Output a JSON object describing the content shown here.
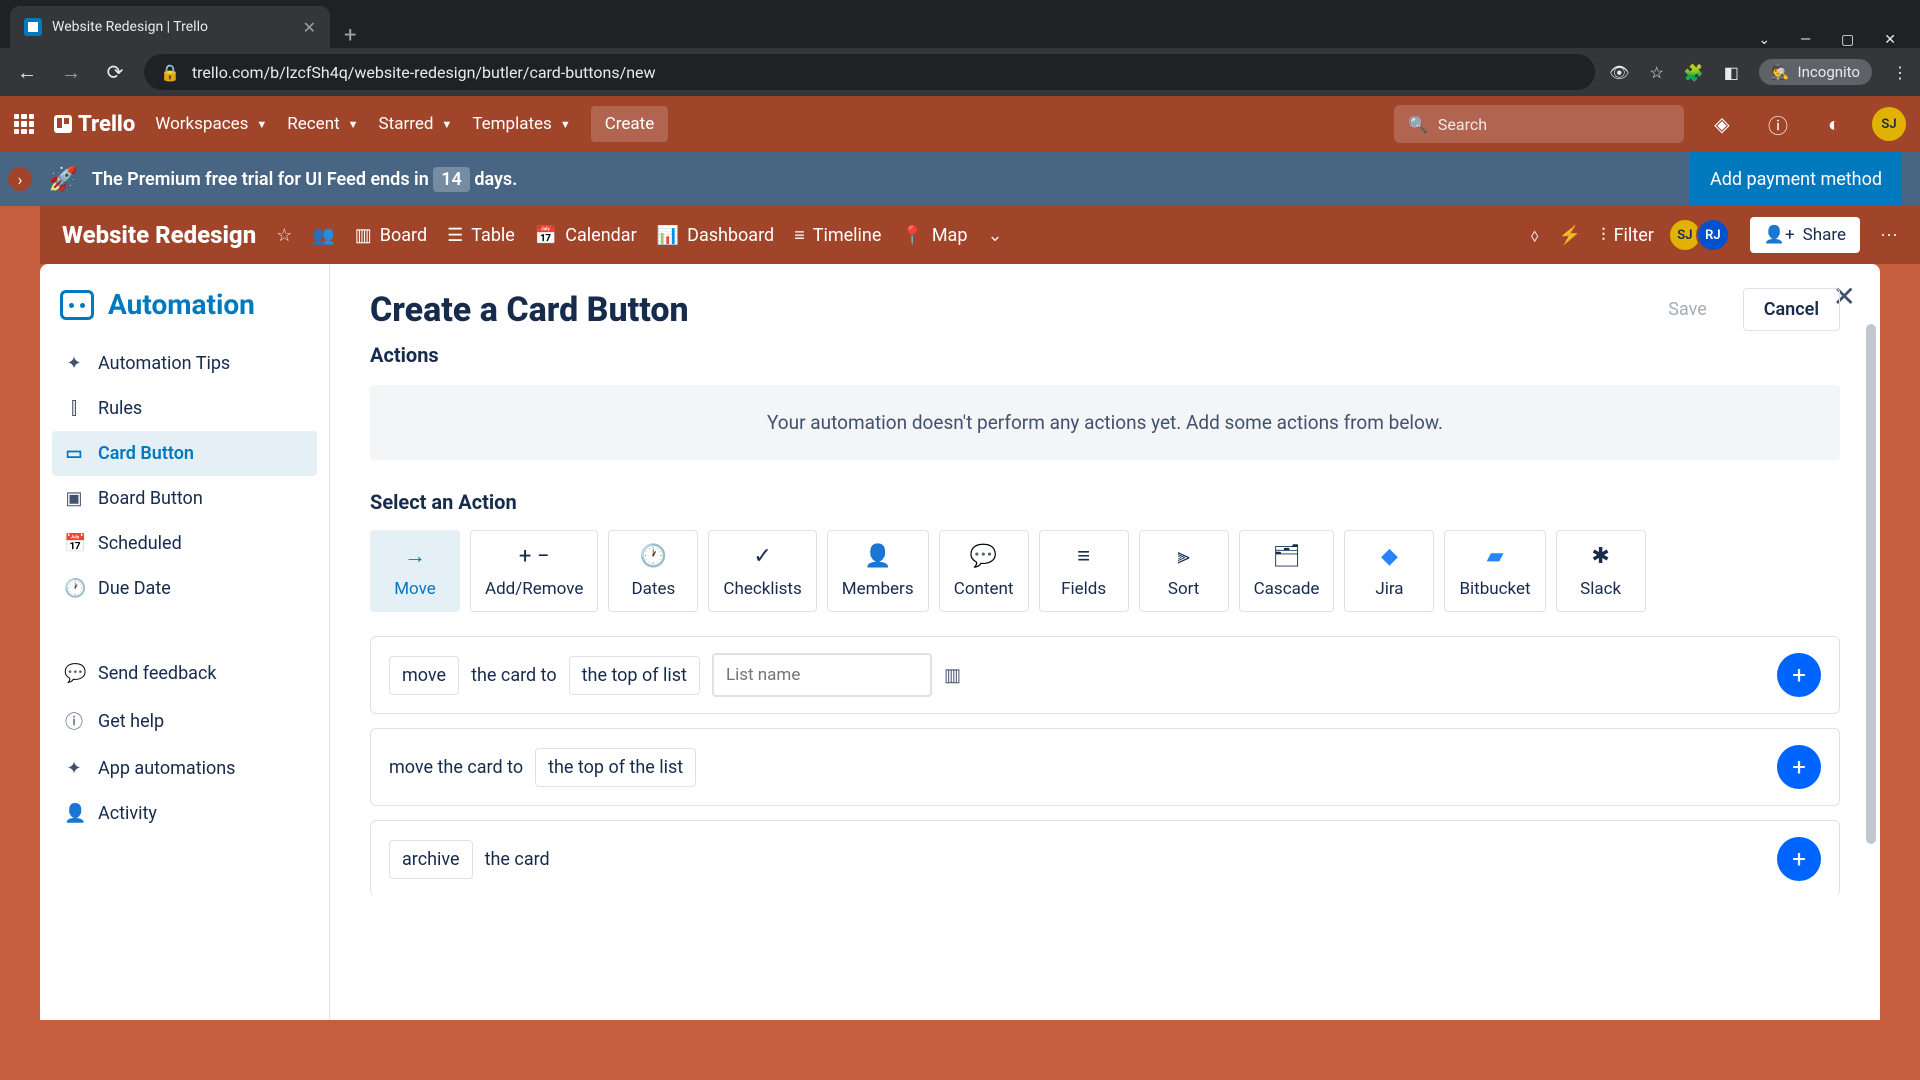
{
  "browser": {
    "tab_title": "Website Redesign | Trello",
    "url": "trello.com/b/lzcfSh4q/website-redesign/butler/card-buttons/new",
    "incognito_label": "Incognito"
  },
  "topnav": {
    "brand": "Trello",
    "workspaces": "Workspaces",
    "recent": "Recent",
    "starred": "Starred",
    "templates": "Templates",
    "create": "Create",
    "search_placeholder": "Search"
  },
  "banner": {
    "text_pre": "The Premium free trial for UI Feed ends in",
    "days": "14",
    "text_post": "days.",
    "cta": "Add payment method"
  },
  "board": {
    "title": "Website Redesign",
    "views": {
      "board": "Board",
      "table": "Table",
      "calendar": "Calendar",
      "dashboard": "Dashboard",
      "timeline": "Timeline",
      "map": "Map"
    },
    "filter": "Filter",
    "share": "Share",
    "members": [
      "SJ",
      "RJ"
    ]
  },
  "automation": {
    "heading": "Automation",
    "sidebar": {
      "tips": "Automation Tips",
      "rules": "Rules",
      "card_button": "Card Button",
      "board_button": "Board Button",
      "scheduled": "Scheduled",
      "due_date": "Due Date",
      "send_feedback": "Send feedback",
      "get_help": "Get help",
      "app_automations": "App automations",
      "activity": "Activity"
    },
    "main": {
      "title": "Create a Card Button",
      "save": "Save",
      "cancel": "Cancel",
      "actions_label": "Actions",
      "empty": "Your automation doesn't perform any actions yet. Add some actions from below.",
      "select_action": "Select an Action",
      "tiles": {
        "move": "Move",
        "add_remove": "Add/Remove",
        "dates": "Dates",
        "checklists": "Checklists",
        "members": "Members",
        "content": "Content",
        "fields": "Fields",
        "sort": "Sort",
        "cascade": "Cascade",
        "jira": "Jira",
        "bitbucket": "Bitbucket",
        "slack": "Slack"
      },
      "row1": {
        "move": "move",
        "the_card_to": "the card to",
        "top_of_list": "the top of list",
        "list_placeholder": "List name"
      },
      "row2": {
        "prefix": "move the card to",
        "chip": "the top of the list"
      },
      "row3": {
        "archive": "archive",
        "the_card": "the card"
      }
    }
  }
}
